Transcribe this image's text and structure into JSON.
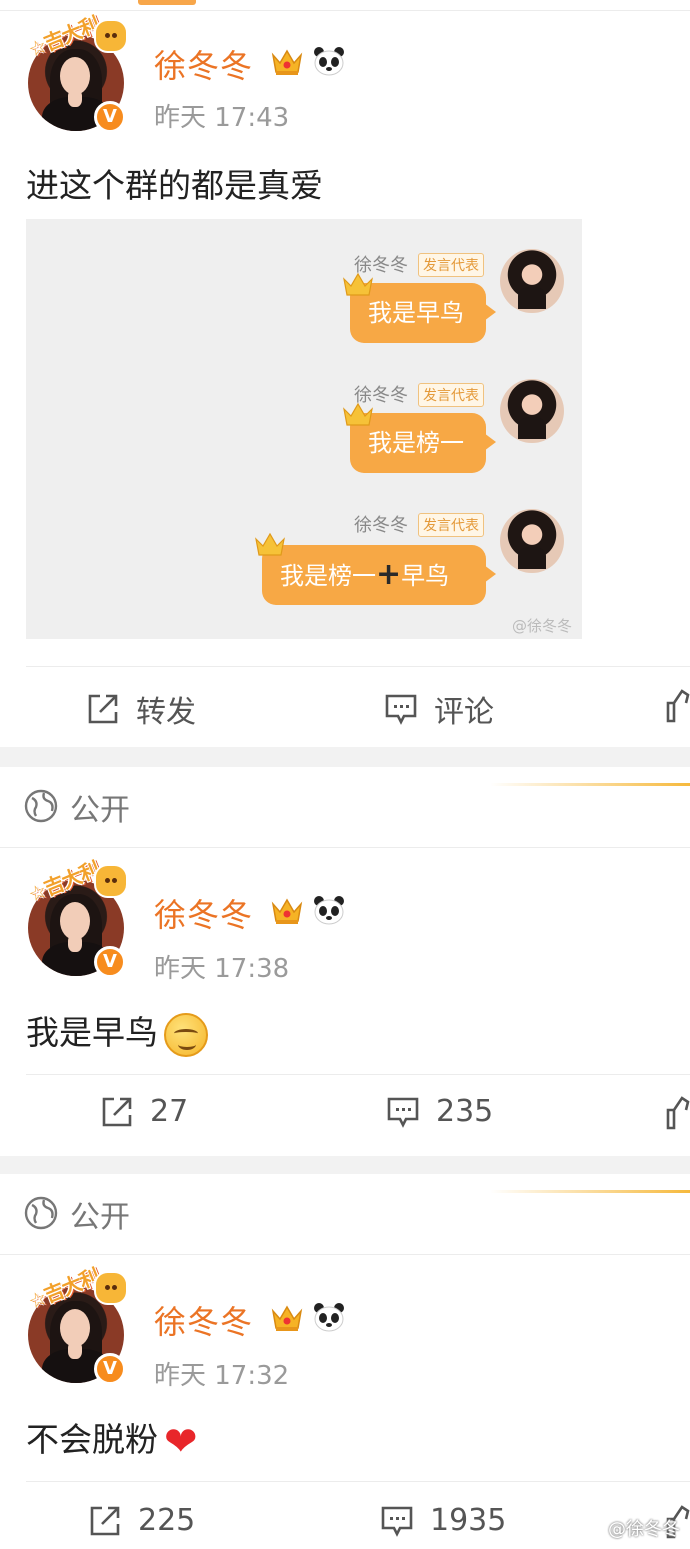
{
  "posts": [
    {
      "author": "徐冬冬",
      "avatar_sticker": "☆吉大利",
      "time": "昨天 17:43",
      "text": "进这个群的都是真爱",
      "image": {
        "messages": [
          {
            "name": "徐冬冬",
            "tag": "发言代表",
            "text": "我是早鸟"
          },
          {
            "name": "徐冬冬",
            "tag": "发言代表",
            "text": "我是榜一"
          },
          {
            "name": "徐冬冬",
            "tag": "发言代表",
            "text_a": "我是榜一",
            "plus": "+",
            "text_b": "早鸟"
          }
        ],
        "watermark": "@徐冬冬"
      },
      "actions": {
        "repost": "转发",
        "comment": "评论"
      }
    },
    {
      "visibility": "公开",
      "author": "徐冬冬",
      "avatar_sticker": "☆吉大利",
      "time": "昨天 17:38",
      "text": "我是早鸟",
      "emoji": "smile-emoji",
      "actions": {
        "repost": "27",
        "comment": "235"
      }
    },
    {
      "visibility": "公开",
      "author": "徐冬冬",
      "avatar_sticker": "☆吉大利",
      "time": "昨天 17:32",
      "text": "不会脱粉",
      "emoji": "❤",
      "actions": {
        "repost": "225",
        "comment": "1935"
      }
    }
  ],
  "corner_watermark": "@徐冬冬",
  "colors": {
    "accent": "#eb7425",
    "bubble": "#f7a845",
    "verified": "#f78c1e",
    "gap": "#f2f2f2"
  }
}
